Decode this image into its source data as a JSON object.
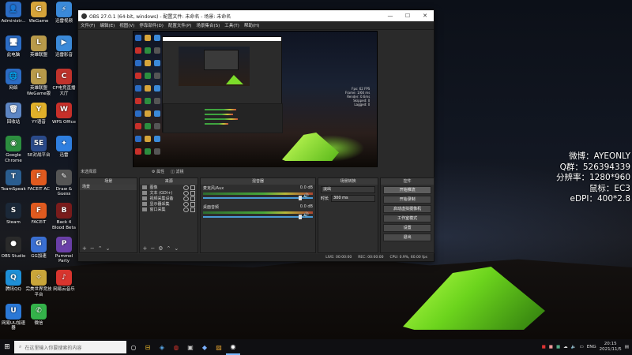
{
  "desktop": {
    "icons": [
      {
        "label": "Administr...",
        "glyph": "👤",
        "color": "#2b6cc4"
      },
      {
        "label": "WeGame",
        "glyph": "G",
        "color": "#d6a43a"
      },
      {
        "label": "迅雷视频",
        "glyph": "⚡",
        "color": "#3b8ad9"
      },
      {
        "label": "此电脑",
        "glyph": "🖥",
        "color": "#2b6cc4"
      },
      {
        "label": "英雄联盟",
        "glyph": "L",
        "color": "#b89a4a"
      },
      {
        "label": "迅雷影音",
        "glyph": "▶",
        "color": "#3b8ad9"
      },
      {
        "label": "网络",
        "glyph": "🌐",
        "color": "#2b6cc4"
      },
      {
        "label": "英雄联盟WeGame版",
        "glyph": "L",
        "color": "#b89a4a"
      },
      {
        "label": "CF电竞直播大厅",
        "glyph": "C",
        "color": "#c0332c"
      },
      {
        "label": "回收站",
        "glyph": "🗑",
        "color": "#5d86c4"
      },
      {
        "label": "YY语音",
        "glyph": "Y",
        "color": "#e0b02a"
      },
      {
        "label": "WPS Office",
        "glyph": "W",
        "color": "#c8302a"
      },
      {
        "label": "Google Chrome",
        "glyph": "◉",
        "color": "#2c8e3f"
      },
      {
        "label": "5E对战平台",
        "glyph": "5E",
        "color": "#2a4a8a"
      },
      {
        "label": "迅雷",
        "glyph": "✦",
        "color": "#2f7fe0"
      },
      {
        "label": "TeamSpeak",
        "glyph": "T",
        "color": "#2a5d8f"
      },
      {
        "label": "FACEIT AC",
        "glyph": "F",
        "color": "#e05a1f"
      },
      {
        "label": "Draw & Guess",
        "glyph": "✎",
        "color": "#555"
      },
      {
        "label": "Steam",
        "glyph": "S",
        "color": "#1b2838"
      },
      {
        "label": "FACEIT",
        "glyph": "F",
        "color": "#e05a1f"
      },
      {
        "label": "Back 4 Blood Beta",
        "glyph": "B",
        "color": "#7a1c1c"
      },
      {
        "label": "OBS Studio",
        "glyph": "●",
        "color": "#2a2a2a"
      },
      {
        "label": "GG加速",
        "glyph": "G",
        "color": "#3a6fd1"
      },
      {
        "label": "Pummel Party",
        "glyph": "P",
        "color": "#6a3fa8"
      },
      {
        "label": "腾讯QQ",
        "glyph": "Q",
        "color": "#1e8fd6"
      },
      {
        "label": "完美世界竞技平台",
        "glyph": "✧",
        "color": "#c9a53a"
      },
      {
        "label": "网易云音乐",
        "glyph": "♪",
        "color": "#d8352e"
      },
      {
        "label": "网易UU加速器",
        "glyph": "U",
        "color": "#2b78d6"
      },
      {
        "label": "微信",
        "glyph": "✆",
        "color": "#34b24a"
      }
    ]
  },
  "overlay": {
    "weibo": "微博：AYEONLY",
    "qq": "Q群：526394339",
    "resolution": "分辨率：1280*960",
    "mouse": "鼠标：EC3",
    "edpi": "eDPI：400*2.8"
  },
  "obs": {
    "title": "OBS 27.0.1 (64-bit, windows) - 配置文件: 未命名 - 场景: 未命名",
    "menu": [
      "文件(F)",
      "编辑(E)",
      "视图(V)",
      "停靠部件(D)",
      "配置文件(P)",
      "场景集合(S)",
      "工具(T)",
      "帮助(H)"
    ],
    "preview_stats": [
      "Fps: 62 FPS",
      "Frame: 1/60 ms",
      "Render: 0.6ms",
      "Skipped: 0",
      "Lagged: 0"
    ],
    "scene_bar": {
      "label": "未选择源",
      "properties": "属性",
      "filters": "滤镜"
    },
    "docks": {
      "scenes": {
        "title": "场景",
        "items": [
          "场景"
        ]
      },
      "sources": {
        "title": "来源",
        "items": [
          "图像",
          "文本 (GDI+)",
          "视频采集设备",
          "显示器采集",
          "窗口采集"
        ]
      },
      "mixer": {
        "title": "混音器",
        "tracks": [
          {
            "name": "麦克风/Aux",
            "db": "0.0 dB"
          },
          {
            "name": "桌面音频",
            "db": "0.0 dB"
          }
        ]
      },
      "transitions": {
        "title": "场景转换",
        "type": "淡出",
        "duration_label": "时长",
        "duration": "300 ms"
      },
      "controls": {
        "title": "控件",
        "buttons": [
          "开始推流",
          "开始录制",
          "启动虚拟摄像机",
          "工作室模式",
          "设置",
          "退出"
        ]
      }
    },
    "status": {
      "live": "LIVE: 00:00:00",
      "rec": "REC: 00:00:00",
      "cpu": "CPU: 0.9%, 60.00 fps"
    }
  },
  "taskbar": {
    "search_placeholder": "在这里输入你要搜索的内容",
    "tray": {
      "lang": "ENG",
      "time": "20:15",
      "date": "2021/11/5"
    }
  }
}
